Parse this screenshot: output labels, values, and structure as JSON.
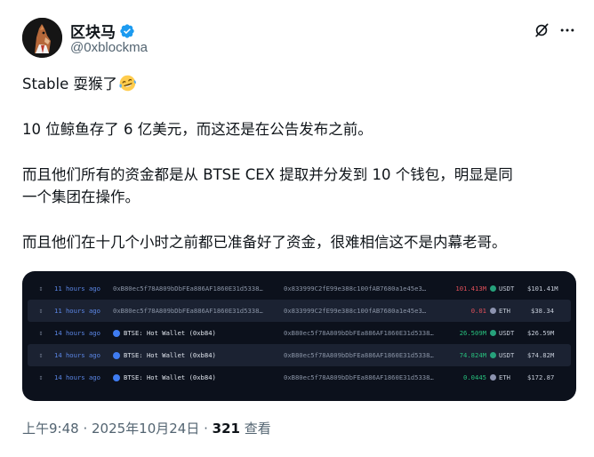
{
  "author": {
    "display_name": "区块马",
    "handle": "@0xblockma"
  },
  "tweet": {
    "line1": "Stable 耍猴了",
    "line2": "10 位鲸鱼存了 6 亿美元，而这还是在公告发布之前。",
    "line3": "而且他们所有的资金都是从 BTSE CEX 提取并分发到 10 个钱包，明显是同\n一个集团在操作。",
    "line4": "而且他们在十几个小时之前都已准备好了资金，很难相信这不是内幕老哥。"
  },
  "transactions": [
    {
      "time": "11 hours ago",
      "from": "0xB80ec5f78A809bDbFEa886AF1860E31d5338…",
      "to": "0x833999C2fE99e388c100fAB7680a1e45e3…",
      "amount": "101.413M",
      "amount_sign": "neg",
      "token": "USDT",
      "value": "$101.41M"
    },
    {
      "time": "11 hours ago",
      "from": "0xB80ec5f78A809bDbFEa886AF1860E31d5338…",
      "to": "0x833999C2fE99e388c100fAB7680a1e45e3…",
      "amount": "0.01",
      "amount_sign": "neg",
      "token": "ETH",
      "value": "$38.34"
    },
    {
      "time": "14 hours ago",
      "from": "BTSE: Hot Wallet (0xb84)",
      "to": "0xB80ec5f78A809bDbFEa886AF1860E31d5338…",
      "amount": "26.509M",
      "amount_sign": "pos",
      "token": "USDT",
      "value": "$26.59M"
    },
    {
      "time": "14 hours ago",
      "from": "BTSE: Hot Wallet (0xb84)",
      "to": "0xB80ec5f78A809bDbFEa886AF1860E31d5338…",
      "amount": "74.824M",
      "amount_sign": "pos",
      "token": "USDT",
      "value": "$74.82M"
    },
    {
      "time": "14 hours ago",
      "from": "BTSE: Hot Wallet (0xb84)",
      "to": "0xB80ec5f78A809bDbFEa886AF1860E31d5338…",
      "amount": "0.0445",
      "amount_sign": "pos",
      "token": "ETH",
      "value": "$172.87"
    }
  ],
  "footer": {
    "timestamp": "上午9:48 · 2025年10月24日 · ",
    "views_count": "321",
    "views_label": " 查看"
  },
  "colors": {
    "verified": "#1d9bf0",
    "usdt": "#26a17b",
    "eth": "#8c93af"
  }
}
